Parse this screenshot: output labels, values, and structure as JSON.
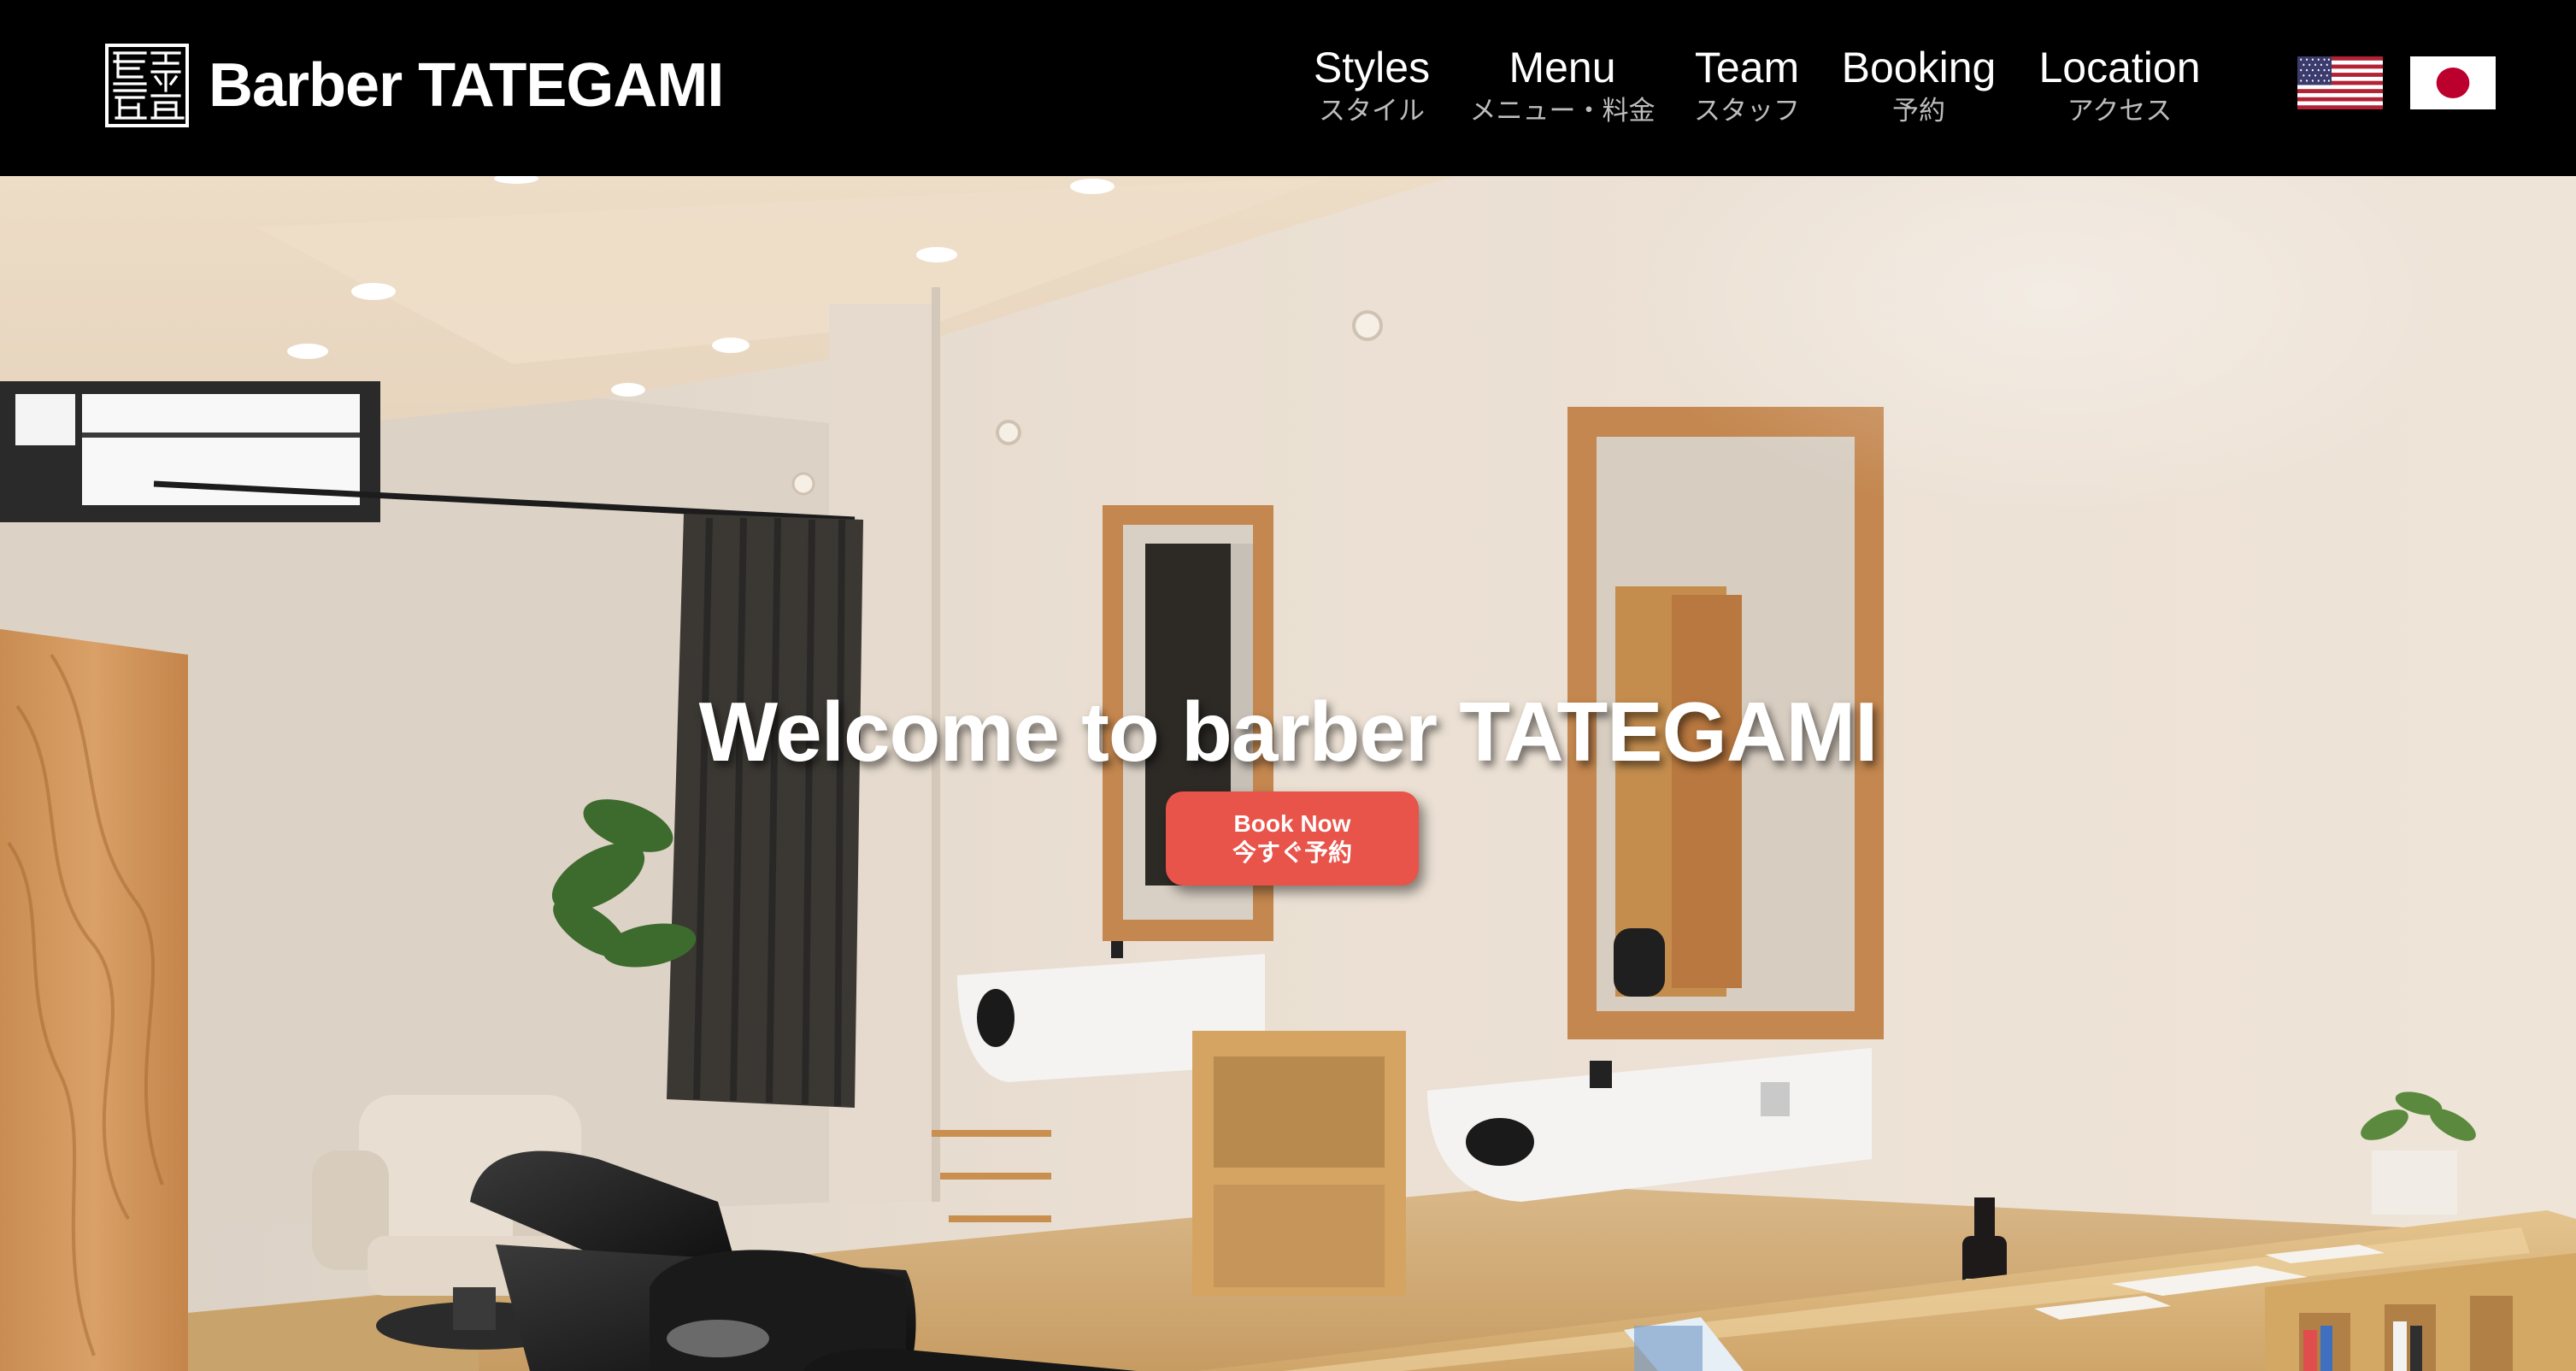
{
  "site": {
    "brand_name": "Barber TATEGAMI",
    "logo_icon": "tategami-seal-logo"
  },
  "nav": {
    "items": [
      {
        "en": "Styles",
        "ja": "スタイル"
      },
      {
        "en": "Menu",
        "ja": "メニュー・料金"
      },
      {
        "en": "Team",
        "ja": "スタッフ"
      },
      {
        "en": "Booking",
        "ja": "予約"
      },
      {
        "en": "Location",
        "ja": "アクセス"
      }
    ],
    "languages": [
      {
        "icon": "us-flag-icon",
        "language": "English"
      },
      {
        "icon": "japan-flag-icon",
        "language": "Japanese"
      }
    ]
  },
  "hero": {
    "title": "Welcome to barber TATEGAMI",
    "book_button": {
      "line1": "Book Now",
      "line2": "今すぐ予約"
    },
    "photo_icon": "barbershop-interior-photo"
  },
  "colors": {
    "header_bg": "#000000",
    "accent": "#e8534a",
    "nav_text": "#ffffff",
    "nav_subtext": "#bdbdbd"
  }
}
